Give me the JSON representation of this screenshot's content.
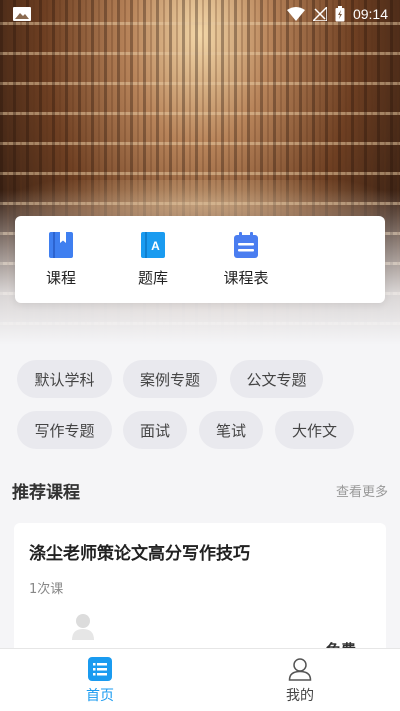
{
  "status_bar": {
    "time": "09:14"
  },
  "quick_menu": [
    {
      "label": "课程",
      "icon": "book-icon",
      "color": "#3f7ff0"
    },
    {
      "label": "题库",
      "icon": "question-bank-icon",
      "color": "#1a9bf0"
    },
    {
      "label": "课程表",
      "icon": "calendar-icon",
      "color": "#4a7df0"
    }
  ],
  "tags": [
    "默认学科",
    "案例专题",
    "公文专题",
    "写作专题",
    "面试",
    "笔试",
    "大作文"
  ],
  "section": {
    "title": "推荐课程",
    "more": "查看更多"
  },
  "course": {
    "title": "涤尘老师策论文高分写作技巧",
    "lessons": "1次课",
    "price": "免费"
  },
  "bottom_nav": [
    {
      "label": "首页",
      "icon": "home-list-icon",
      "active": true
    },
    {
      "label": "我的",
      "icon": "user-icon",
      "active": false
    }
  ],
  "colors": {
    "accent": "#1a9bf0",
    "background": "#f5f5f7"
  }
}
